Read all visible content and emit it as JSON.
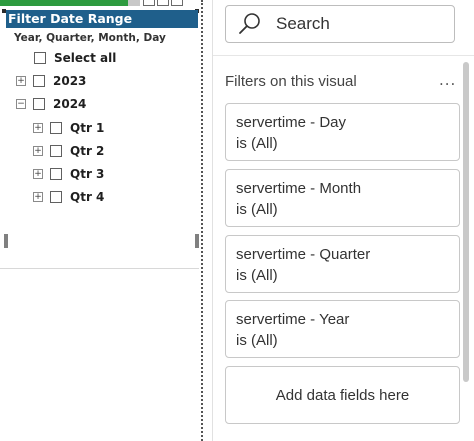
{
  "slicer": {
    "title": "Filter Date Range",
    "hierarchy_label": "Year, Quarter, Month, Day",
    "select_all": "Select all",
    "years": [
      {
        "label": "2023",
        "expander": "+"
      },
      {
        "label": "2024",
        "expander": "−"
      }
    ],
    "quarters": [
      {
        "label": "Qtr 1",
        "expander": "+"
      },
      {
        "label": "Qtr 2",
        "expander": "+"
      },
      {
        "label": "Qtr 3",
        "expander": "+"
      },
      {
        "label": "Qtr 4",
        "expander": "+"
      }
    ]
  },
  "filters_pane": {
    "search_placeholder": "Search",
    "section_title": "Filters on this visual",
    "more_options": "...",
    "filters": [
      {
        "field": "servertime - Day",
        "state": "is (All)"
      },
      {
        "field": "servertime - Month",
        "state": "is (All)"
      },
      {
        "field": "servertime - Quarter",
        "state": "is (All)"
      },
      {
        "field": "servertime - Year",
        "state": "is (All)"
      }
    ],
    "add_fields": "Add data fields here"
  },
  "colors": {
    "header_bg": "#1f5f8b",
    "accent_green": "#2e9b3f"
  }
}
